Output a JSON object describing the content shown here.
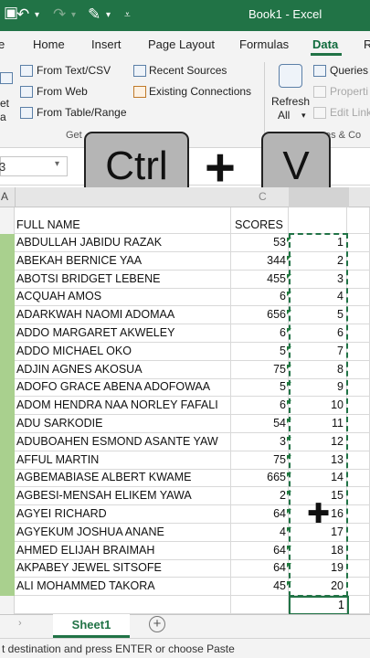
{
  "window": {
    "title": "Book1  -  Excel",
    "undo_icon": "undo-icon",
    "redo_icon": "redo-icon"
  },
  "tabs": [
    "e",
    "Home",
    "Insert",
    "Page Layout",
    "Formulas",
    "Data",
    "R"
  ],
  "active_tab": "Data",
  "ribbon": {
    "get_data_items": [
      "From Text/CSV",
      "From Web",
      "From Table/Range"
    ],
    "recent_items": [
      "Recent Sources",
      "Existing Connections"
    ],
    "group_label_get": "Get",
    "left_fragments": [
      "et",
      "a"
    ],
    "refresh_label": "Refresh",
    "refresh_all": "All",
    "queries": [
      "Queries &",
      "Properti",
      "Edit Link"
    ],
    "group_label_queries": "es & Co"
  },
  "formula_bar": {
    "name_box_fragment": "3"
  },
  "keys": {
    "ctrl": "Ctrl",
    "plus": "+",
    "v": "V"
  },
  "column_headers": [
    "A",
    "C"
  ],
  "table": {
    "header_name": "FULL NAME",
    "header_scores": "SCORES",
    "rows": [
      {
        "name": "ABDULLAH JABIDU RAZAK",
        "score": "53",
        "paste": "1"
      },
      {
        "name": "ABEKAH BERNICE YAA",
        "score": "344",
        "paste": "2"
      },
      {
        "name": "ABOTSI BRIDGET LEBENE",
        "score": "455",
        "paste": "3"
      },
      {
        "name": "ACQUAH AMOS",
        "score": "6",
        "paste": "4"
      },
      {
        "name": "ADARKWAH NAOMI ADOMAA",
        "score": "656",
        "paste": "5"
      },
      {
        "name": "ADDO MARGARET AKWELEY",
        "score": "6",
        "paste": "6"
      },
      {
        "name": "ADDO MICHAEL OKO",
        "score": "5",
        "paste": "7"
      },
      {
        "name": "ADJIN AGNES AKOSUA",
        "score": "75",
        "paste": "8"
      },
      {
        "name": "ADOFO GRACE ABENA ADOFOWAA",
        "score": "5",
        "paste": "9"
      },
      {
        "name": "ADOM HENDRA NAA NORLEY FAFALI",
        "score": "6",
        "paste": "10"
      },
      {
        "name": "ADU SARKODIE",
        "score": "54",
        "paste": "11"
      },
      {
        "name": "ADUBOAHEN ESMOND ASANTE YAW",
        "score": "3",
        "paste": "12"
      },
      {
        "name": "AFFUL MARTIN",
        "score": "75",
        "paste": "13"
      },
      {
        "name": "AGBEMABIASE ALBERT KWAME",
        "score": "665",
        "paste": "14"
      },
      {
        "name": "AGBESI-MENSAH ELIKEM YAWA",
        "score": "2",
        "paste": "15"
      },
      {
        "name": "AGYEI RICHARD",
        "score": "64",
        "paste": "16"
      },
      {
        "name": "AGYEKUM JOSHUA ANANE",
        "score": "4",
        "paste": "17"
      },
      {
        "name": "AHMED ELIJAH BRAIMAH",
        "score": "64",
        "paste": "18"
      },
      {
        "name": "AKPABEY JEWEL SITSOFE",
        "score": "64",
        "paste": "19"
      },
      {
        "name": "ALI MOHAMMED TAKORA",
        "score": "45",
        "paste": "20"
      }
    ],
    "active_cell_value": "1"
  },
  "sheet_tabs": [
    "Sheet1"
  ],
  "add_sheet": "+",
  "status": "t destination and press ENTER or choose Paste",
  "colors": {
    "excel_green": "#217346",
    "row_header_selected": "#a9d08e"
  }
}
